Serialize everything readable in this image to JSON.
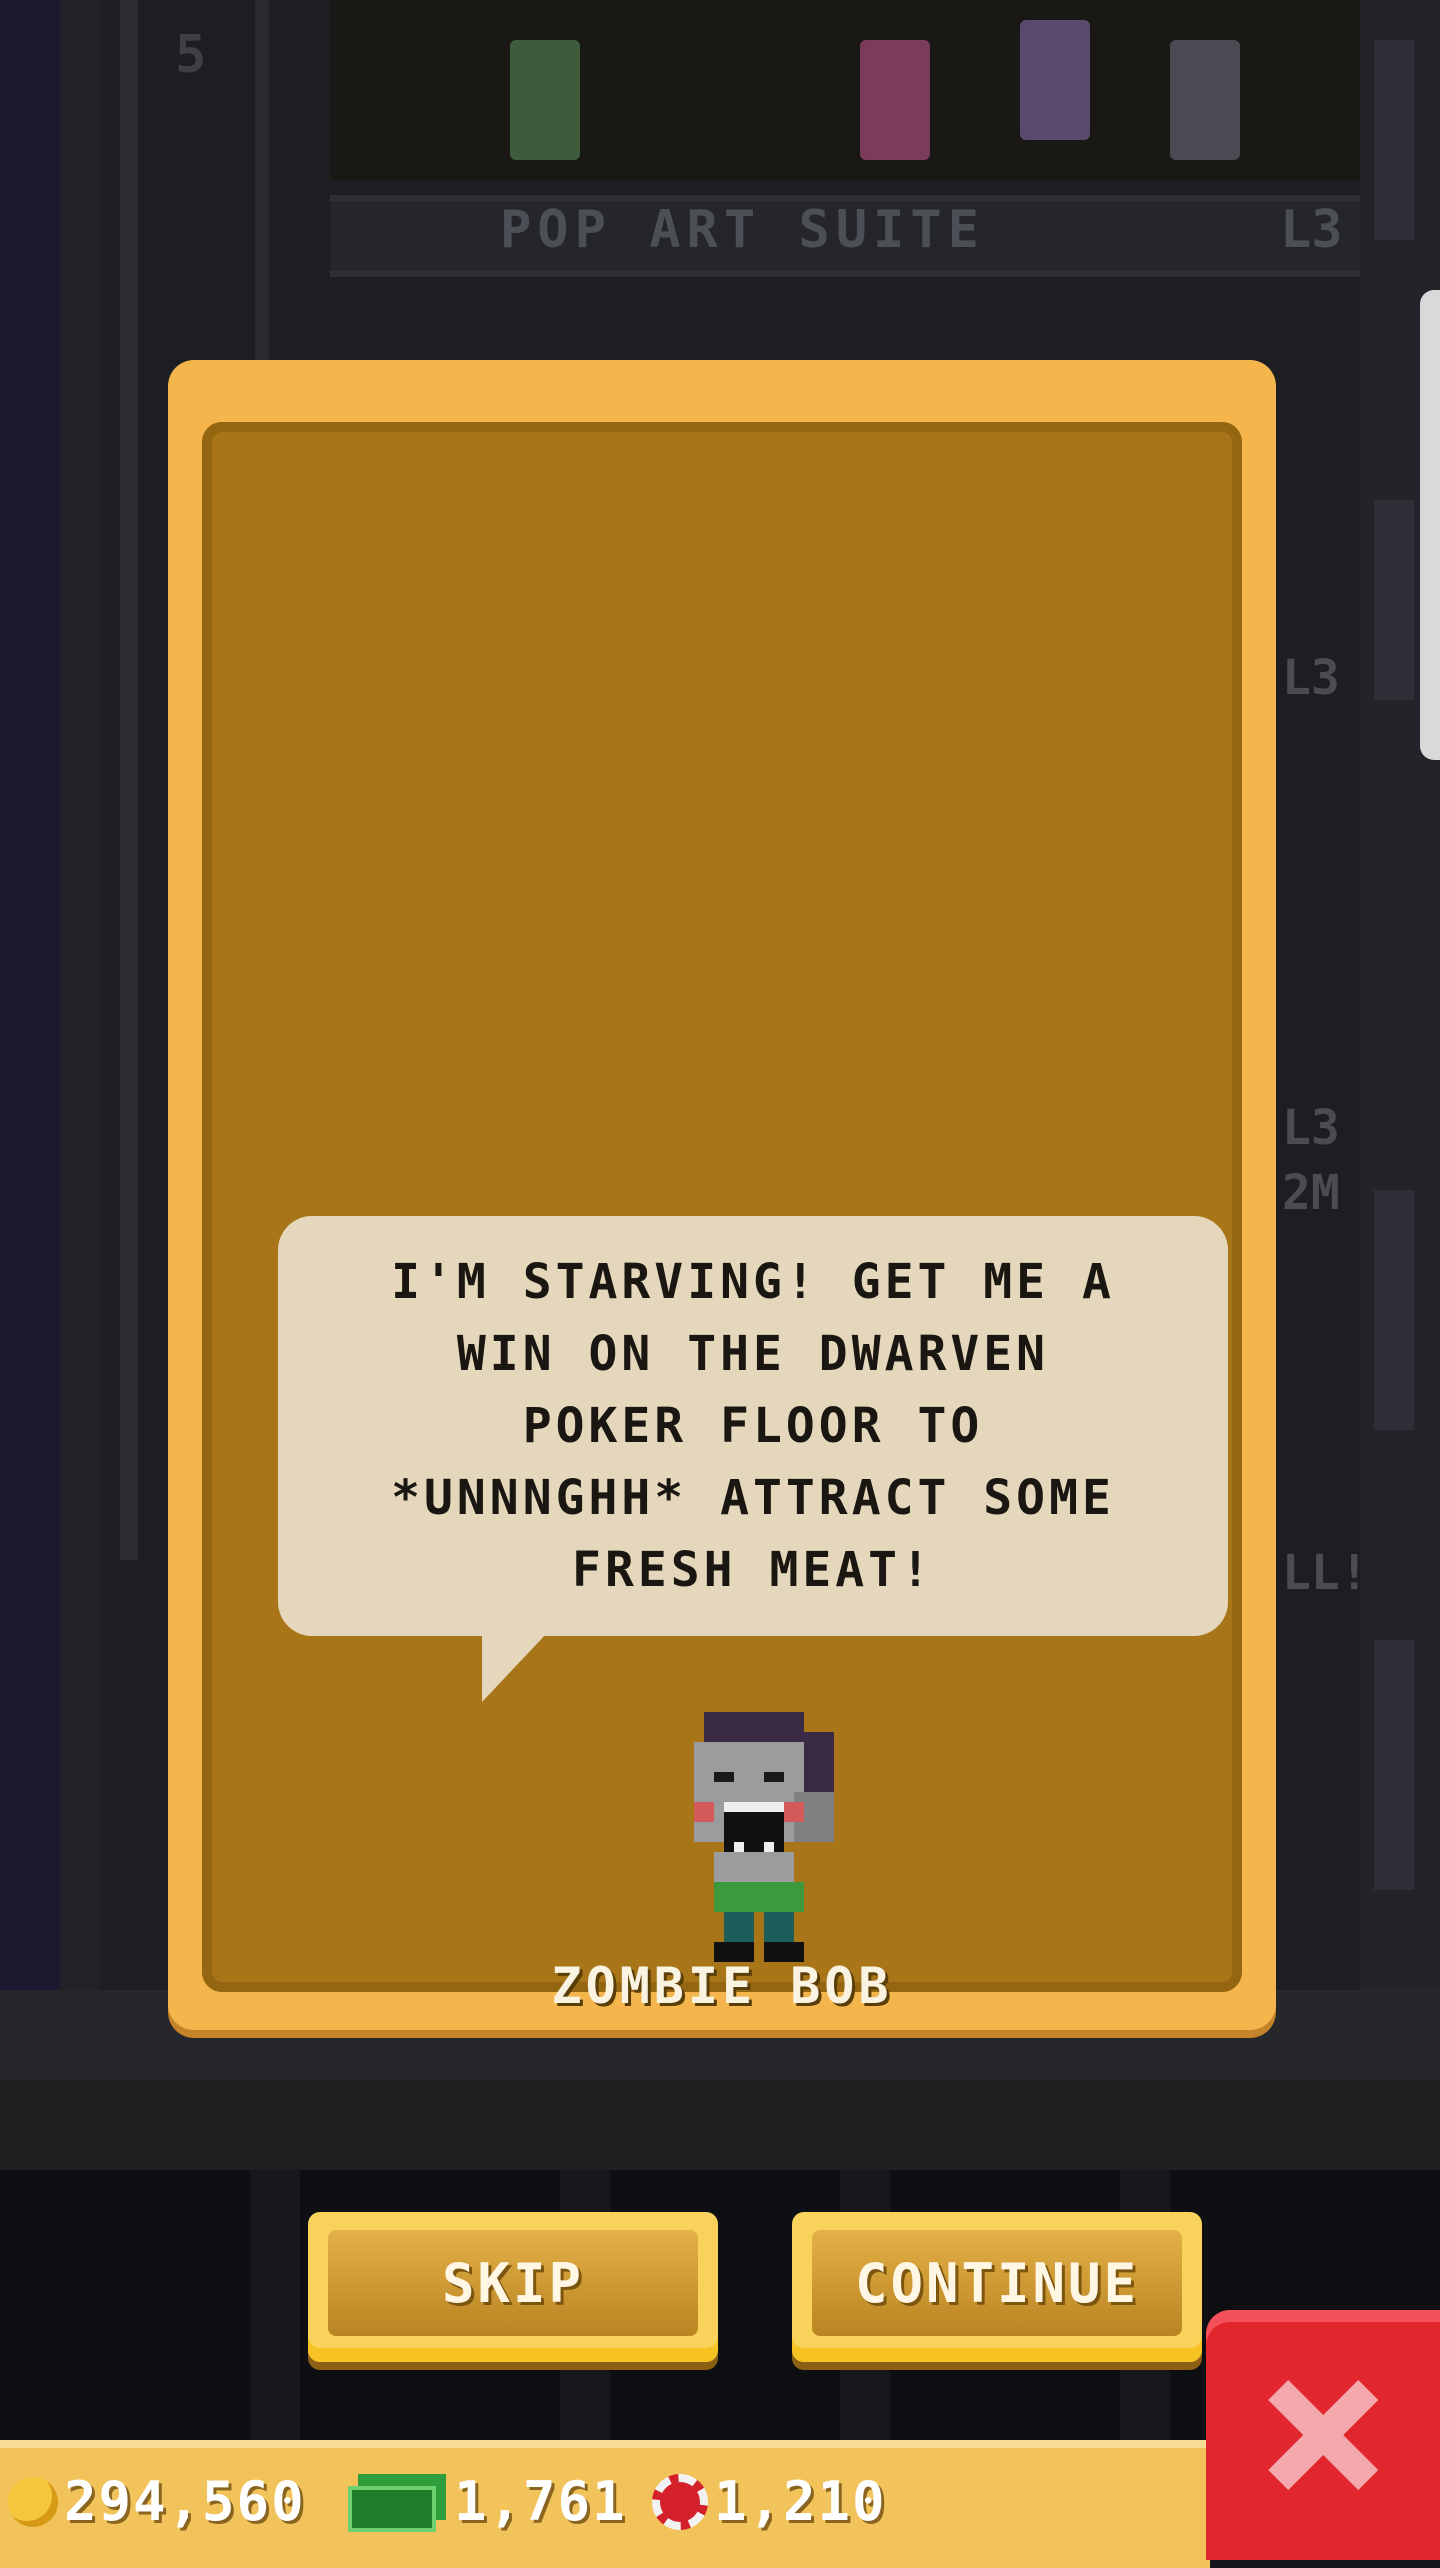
{
  "background": {
    "floor_number": "5",
    "floor_name": "POP ART SUITE",
    "floor_level": "L3",
    "side_tags": [
      "L3",
      "L3",
      "2M",
      "LL!"
    ]
  },
  "dialog": {
    "message": "I'M STARVING! GET ME A WIN ON THE DWARVEN POKER FLOOR TO *UNNNGHH* ATTRACT SOME FRESH MEAT!",
    "character_name": "ZOMBIE BOB",
    "character_icon": "zombie-avatar",
    "skip_label": "SKIP",
    "continue_label": "CONTINUE"
  },
  "hud": {
    "coins": "294,560",
    "coin_icon": "coin-icon",
    "bux": "1,761",
    "bux_icon": "cash-icon",
    "chips": "1,210",
    "chip_icon": "chip-icon",
    "close_icon": "close-icon"
  },
  "colors": {
    "modal_border": "#f3b54c",
    "modal_fill": "#a87618",
    "speech_bubble": "#e5d7bb",
    "close_button": "#e2262d",
    "hud_bar": "#f1c35a"
  }
}
